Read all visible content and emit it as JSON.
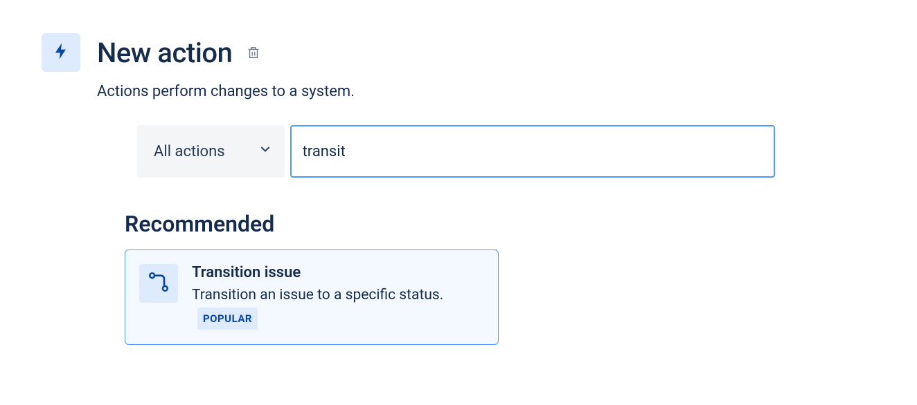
{
  "header": {
    "title": "New action",
    "subtitle": "Actions perform changes to a system."
  },
  "filter": {
    "dropdown_label": "All actions",
    "search_value": "transit"
  },
  "section": {
    "heading": "Recommended"
  },
  "result": {
    "title": "Transition issue",
    "description": "Transition an issue to a specific status.",
    "badge": "POPULAR"
  }
}
